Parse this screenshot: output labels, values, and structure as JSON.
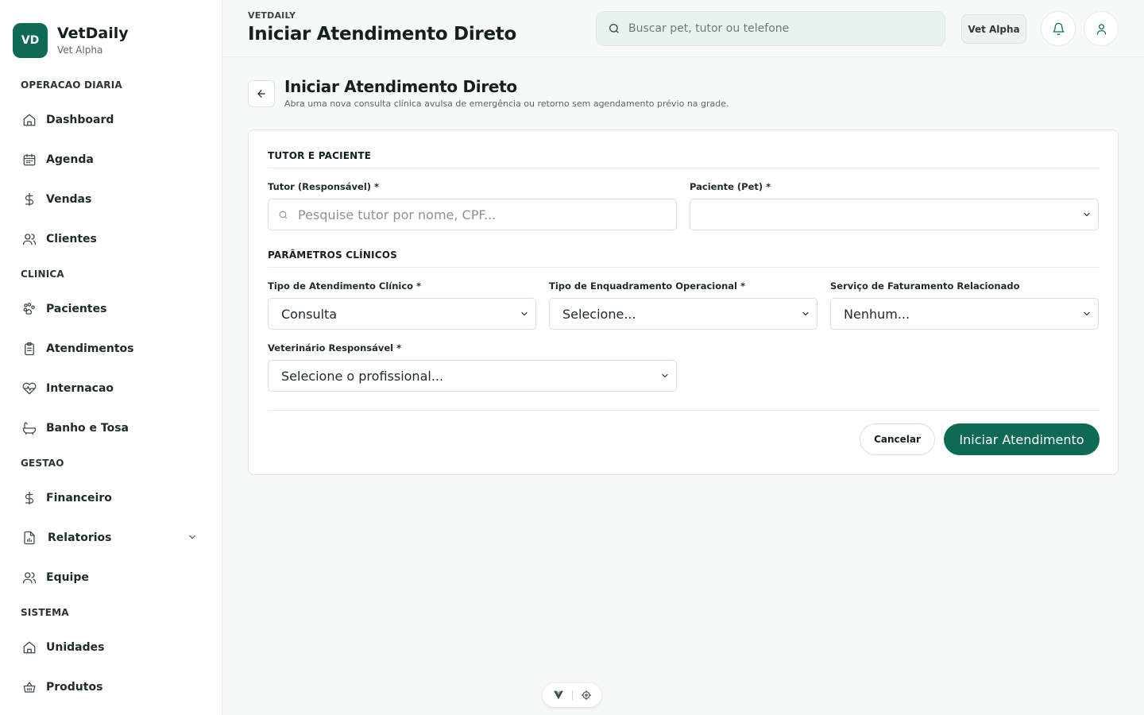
{
  "brand": {
    "initials": "VD",
    "name": "VetDaily",
    "unit": "Vet Alpha"
  },
  "sidebar": {
    "sections": [
      {
        "title": "OPERACAO DIARIA",
        "items": [
          "Dashboard",
          "Agenda",
          "Vendas",
          "Clientes"
        ]
      },
      {
        "title": "CLINICA",
        "items": [
          "Pacientes",
          "Atendimentos",
          "Internacao",
          "Banho e Tosa"
        ]
      },
      {
        "title": "GESTAO",
        "items": [
          "Financeiro",
          "Relatorios",
          "Equipe"
        ]
      },
      {
        "title": "SISTEMA",
        "items": [
          "Unidades",
          "Produtos"
        ]
      }
    ]
  },
  "header": {
    "eyebrow": "VETDAILY",
    "title": "Iniciar Atendimento Direto",
    "search_placeholder": "Buscar pet, tutor ou telefone",
    "unit_button": "Vet Alpha"
  },
  "page": {
    "title": "Iniciar Atendimento Direto",
    "subtitle": "Abra uma nova consulta clínica avulsa de emergência ou retorno sem agendamento prévio na grade."
  },
  "form": {
    "section_tutor": "TUTOR E PACIENTE",
    "tutor_label": "Tutor (Responsável) *",
    "tutor_placeholder": "Pesquise tutor por nome, CPF...",
    "pet_label": "Paciente (Pet) *",
    "pet_value": "",
    "section_params": "PARÂMETROS CLÍNICOS",
    "tipo_label": "Tipo de Atendimento Clínico *",
    "tipo_value": "Consulta",
    "enquad_label": "Tipo de Enquadramento Operacional *",
    "enquad_value": "Selecione...",
    "servico_label": "Serviço de Faturamento Relacionado",
    "servico_value": "Nenhum...",
    "vet_label": "Veterinário Responsável *",
    "vet_value": "Selecione o profissional...",
    "cancel_label": "Cancelar",
    "submit_label": "Iniciar Atendimento"
  },
  "colors": {
    "accent": "#0f6a55",
    "search_bg": "#e8f3f0"
  },
  "icons": {
    "nav": [
      "home-icon",
      "calendar-icon",
      "dollar-icon",
      "users-icon",
      "paw-icon",
      "clipboard-icon",
      "heart-pulse-icon",
      "bath-icon",
      "dollar-icon",
      "file-chart-icon",
      "users-icon",
      "home-icon",
      "basket-icon"
    ]
  }
}
